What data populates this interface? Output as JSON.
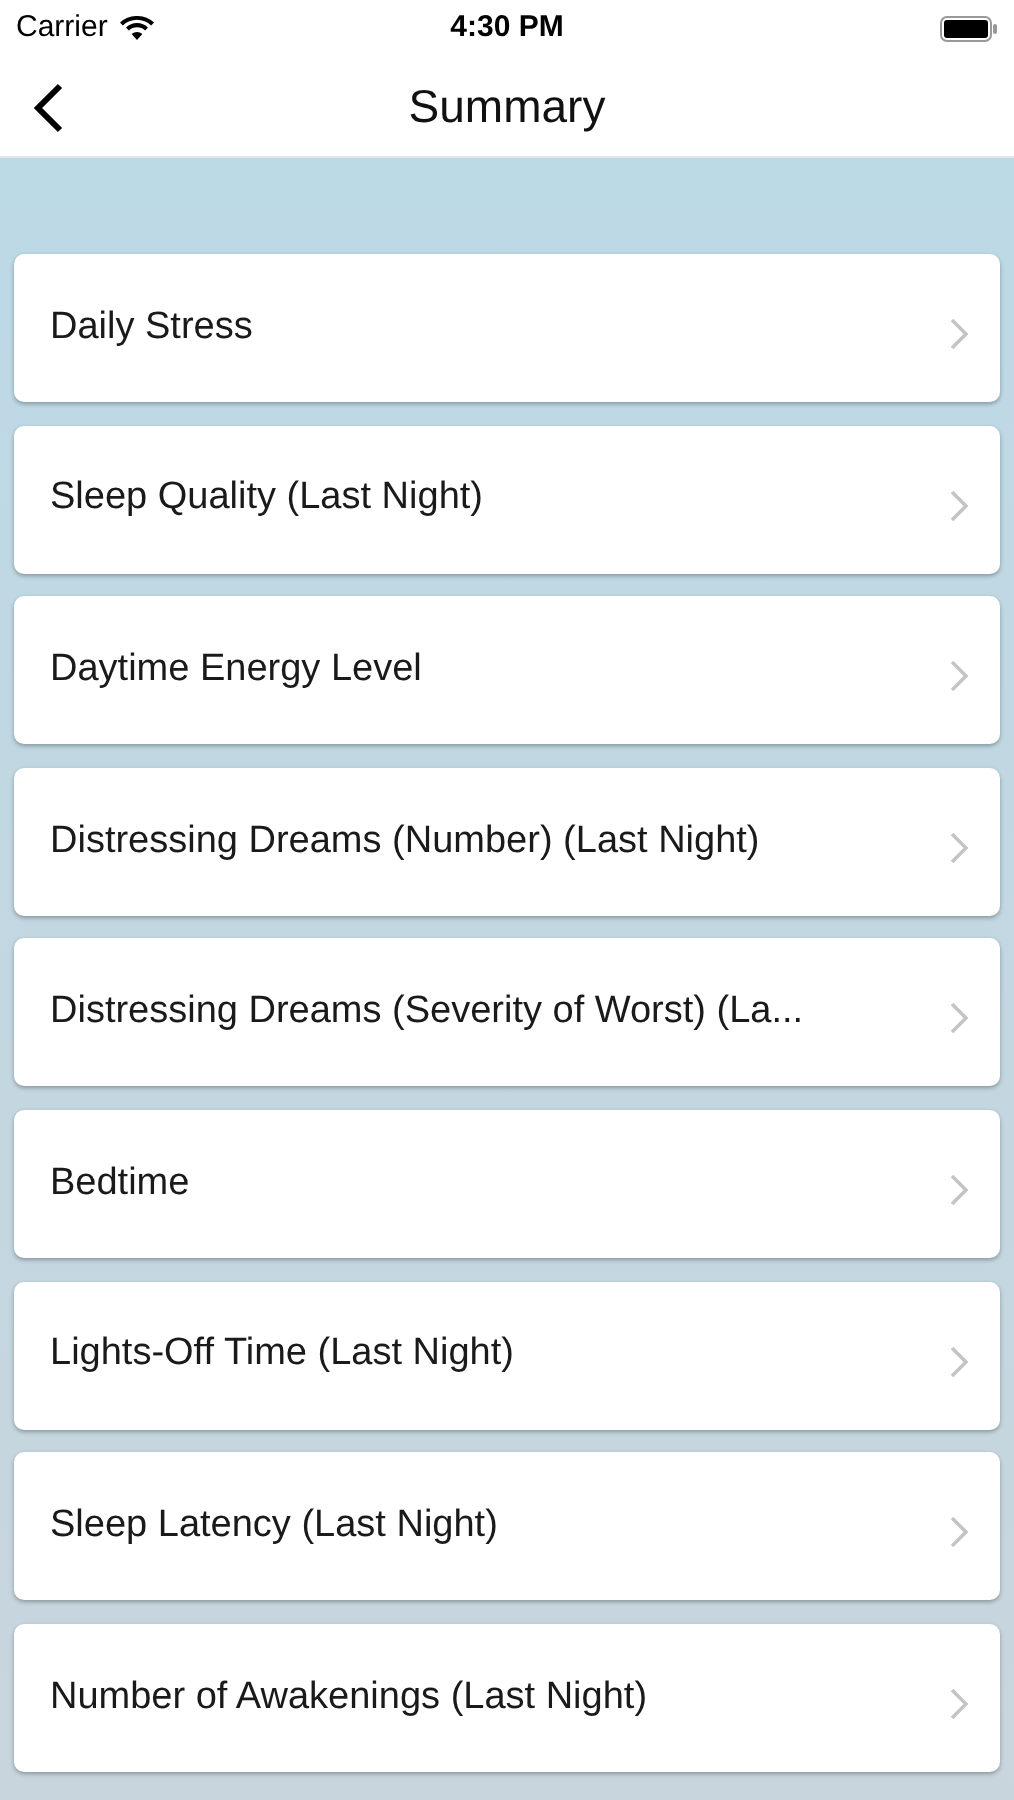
{
  "status_bar": {
    "carrier": "Carrier",
    "time": "4:30 PM"
  },
  "nav_bar": {
    "title": "Summary"
  },
  "items": [
    {
      "label": "Daily Stress"
    },
    {
      "label": "Sleep Quality (Last Night)"
    },
    {
      "label": "Daytime Energy Level"
    },
    {
      "label": "Distressing Dreams (Number) (Last Night)"
    },
    {
      "label": "Distressing Dreams (Severity of Worst) (La..."
    },
    {
      "label": "Bedtime"
    },
    {
      "label": "Lights-Off Time (Last Night)"
    },
    {
      "label": "Sleep Latency (Last Night)"
    },
    {
      "label": "Number of Awakenings (Last Night)"
    }
  ]
}
